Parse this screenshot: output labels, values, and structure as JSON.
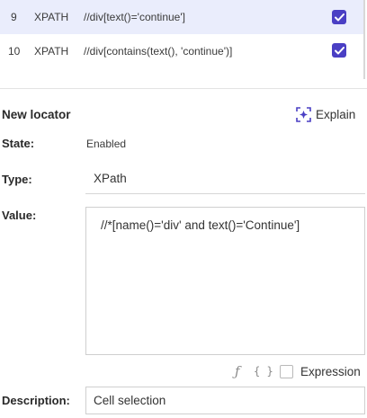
{
  "locators": [
    {
      "index": "9",
      "type": "XPATH",
      "expression": "//div[text()='continue']",
      "checked": true,
      "selected": true
    },
    {
      "index": "10",
      "type": "XPATH",
      "expression": "//div[contains(text(), 'continue')]",
      "checked": true,
      "selected": false
    }
  ],
  "new_locator": {
    "title": "New locator",
    "explain_label": "Explain",
    "state_label": "State:",
    "state_value": "Enabled",
    "type_label": "Type:",
    "type_value": "XPath",
    "value_label": "Value:",
    "value_text": "//*[name()='div' and text()='Continue']",
    "function_icon": "ƒ",
    "braces_icon": "{ }",
    "expression_label": "Expression",
    "expression_checked": false,
    "description_label": "Description:",
    "description_value": "Cell selection"
  },
  "colors": {
    "accent": "#4a3fc4",
    "selected_row_bg": "#eaedfc"
  }
}
